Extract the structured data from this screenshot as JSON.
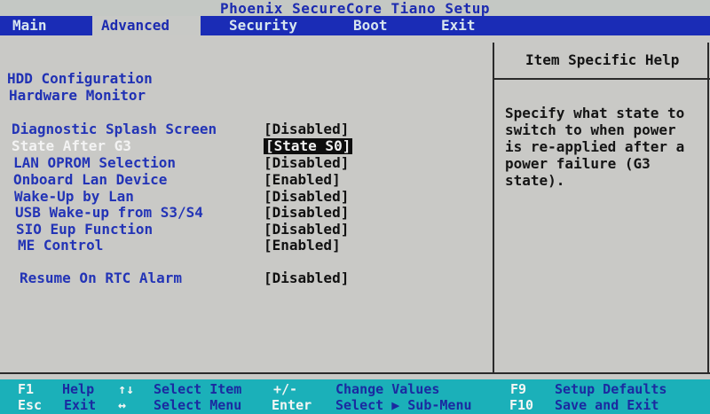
{
  "title": "Phoenix SecureCore Tiano Setup",
  "menu": [
    {
      "label": "Main",
      "active": false
    },
    {
      "label": "Advanced",
      "active": true
    },
    {
      "label": "Security",
      "active": false
    },
    {
      "label": "Boot",
      "active": false
    },
    {
      "label": "Exit",
      "active": false
    }
  ],
  "submenus": [
    {
      "label": "HDD Configuration"
    },
    {
      "label": "Hardware Monitor"
    }
  ],
  "settings": [
    {
      "label": "Diagnostic Splash Screen",
      "value": "[Disabled]"
    },
    {
      "label": "State After G3",
      "value": "[State S0]",
      "selected": true
    },
    {
      "label": "LAN OPROM Selection",
      "value": "[Disabled]"
    },
    {
      "label": "Onboard Lan Device",
      "value": "[Enabled]"
    },
    {
      "label": "Wake-Up by Lan",
      "value": "[Disabled]"
    },
    {
      "label": "USB Wake-up from S3/S4",
      "value": "[Disabled]"
    },
    {
      "label": "SIO Eup Function",
      "value": "[Disabled]"
    },
    {
      "label": "ME Control",
      "value": "[Enabled]"
    },
    {
      "label": "Resume On RTC Alarm",
      "value": "[Disabled]"
    }
  ],
  "help": {
    "title": "Item Specific Help",
    "text": "Specify what state to\nswitch to when power\nis re-applied after a\npower failure (G3\nstate)."
  },
  "footer": {
    "f1_key": "F1",
    "f1_desc": "Help",
    "esc_key": "Esc",
    "esc_desc": "Exit",
    "updown_key": "↑↓",
    "updown_desc": "Select Item",
    "leftright_key": "↔",
    "leftright_desc": "Select Menu",
    "plusminus_key": "+/-",
    "plusminus_desc": "Change Values",
    "enter_key": "Enter",
    "enter_desc": "Select ▶ Sub-Menu",
    "f9_key": "F9",
    "f9_desc": "Setup Defaults",
    "f10_key": "F10",
    "f10_desc": "Save and Exit"
  }
}
